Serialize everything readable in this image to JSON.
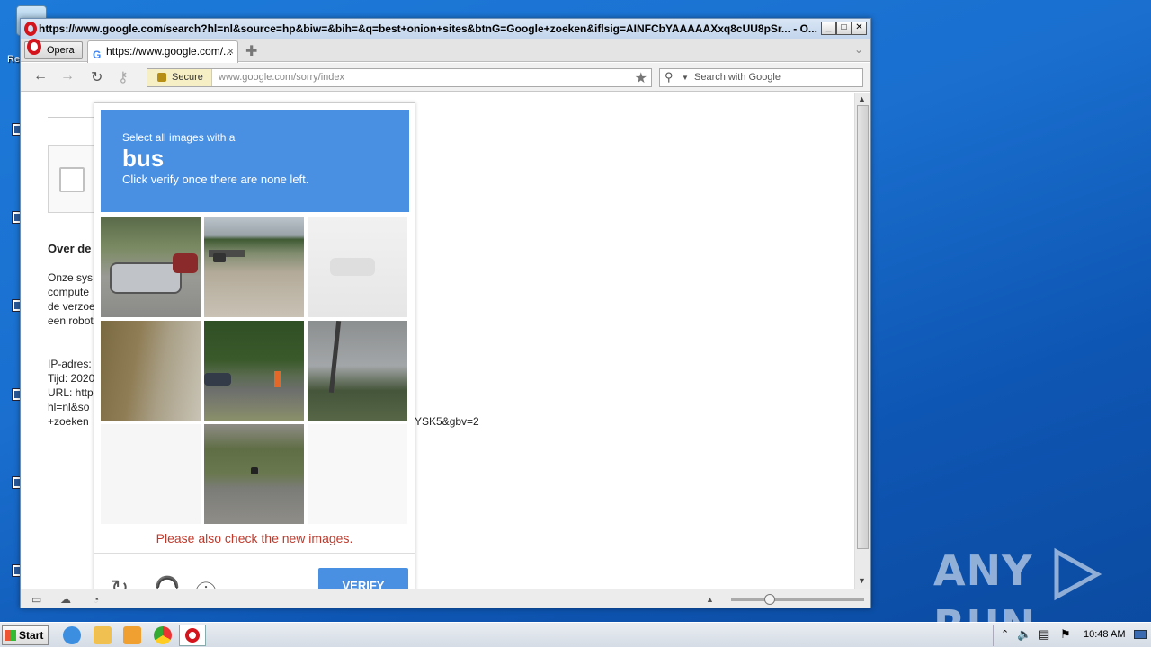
{
  "window": {
    "title": "https://www.google.com/search?hl=nl&source=hp&biw=&bih=&q=best+onion+sites&btnG=Google+zoeken&iflsig=AINFCbYAAAAAXxq8cUU8pSr... - O...",
    "opera_menu": "Opera",
    "tab_title": "https://www.google.com/...",
    "secure_label": "Secure",
    "url_host": "www.google.com",
    "url_path": "/sorry/index",
    "search_placeholder": "Search with Google"
  },
  "page": {
    "heading": "Over de",
    "para_lines": [
      "Onze sys",
      "compute",
      "de verzoe",
      "een robot"
    ],
    "ip_lines": [
      "IP-adres:",
      "Tijd: 2020",
      "URL: http",
      "hl=nl&so",
      "+zoeken"
    ],
    "url_tail": "YSK5&gbv=2"
  },
  "captcha": {
    "instruction_small": "Select all images with a",
    "target_word": "bus",
    "instruction_sub": "Click verify once there are none left.",
    "new_images_msg": "Please also check the new images.",
    "verify_label": "VERIFY"
  },
  "taskbar": {
    "start_label": "Start",
    "clock": "10:48 AM"
  },
  "watermark": "ANY RUN"
}
